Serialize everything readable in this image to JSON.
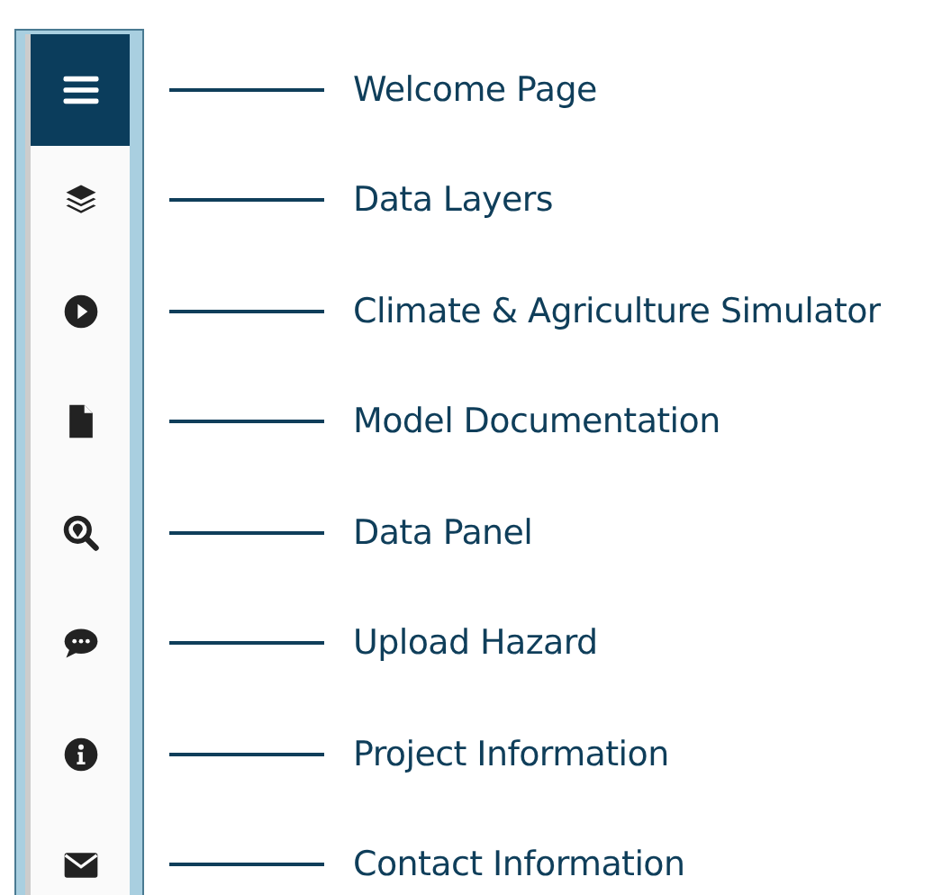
{
  "menu": [
    {
      "label": "Welcome Page",
      "selected": true
    },
    {
      "label": "Data Layers",
      "selected": false
    },
    {
      "label": "Climate & Agriculture Simulator",
      "selected": false
    },
    {
      "label": "Model Documentation",
      "selected": false
    },
    {
      "label": "Data Panel",
      "selected": false
    },
    {
      "label": "Upload Hazard",
      "selected": false
    },
    {
      "label": "Project Information",
      "selected": false
    },
    {
      "label": "Contact Information",
      "selected": false
    }
  ]
}
